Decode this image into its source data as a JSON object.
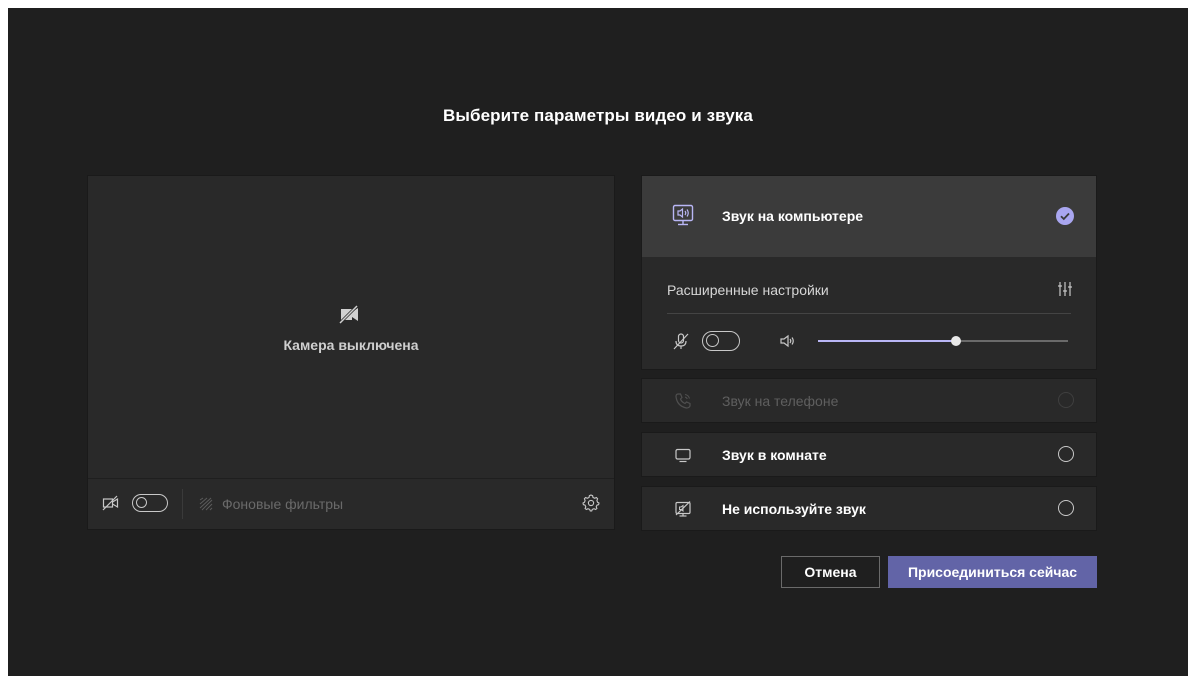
{
  "page": {
    "title": "Выберите параметры видео и звука"
  },
  "video": {
    "camera_status": "Камера выключена",
    "camera_toggle_on": false,
    "background_filters_label": "Фоновые фильтры",
    "icons": [
      "camera-off-icon",
      "background-filters-icon",
      "gear-icon"
    ]
  },
  "audio": {
    "computer": {
      "label": "Звук на компьютере",
      "selected": true,
      "advanced_label": "Расширенные настройки",
      "mic_toggle_on": false,
      "volume_percent": 55
    },
    "options": [
      {
        "id": "phone",
        "label": "Звук на телефоне",
        "disabled": true
      },
      {
        "id": "room",
        "label": "Звук в комнате",
        "disabled": false
      },
      {
        "id": "none",
        "label": "Не используйте звук",
        "disabled": false
      }
    ]
  },
  "actions": {
    "cancel_label": "Отмена",
    "join_label": "Присоединиться сейчас"
  },
  "colors": {
    "accent": "#6264a7",
    "check": "#a9a6f0",
    "background": "#1f1f1f",
    "panel": "#292929",
    "selected_panel": "#3b3b3b"
  }
}
